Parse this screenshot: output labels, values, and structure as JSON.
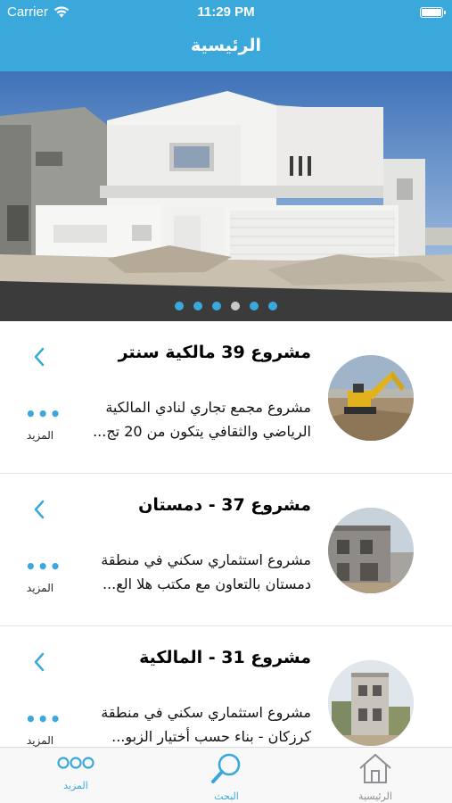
{
  "status_bar": {
    "carrier": "Carrier",
    "time": "11:29 PM",
    "battery_level": 1.0
  },
  "nav": {
    "title": "الرئيسية"
  },
  "slider": {
    "pages": 6,
    "active_index": 3
  },
  "list": {
    "items": [
      {
        "title": "مشروع 39 مالكية سنتر",
        "line1": "مشروع مجمع تجاري لنادي المالكية",
        "line2": "الرياضي والثقافي يتكون من 20 تج...",
        "more_label": "المزيد",
        "thumb": "excavator-photo"
      },
      {
        "title": "مشروع 37 - دمستان",
        "line1": "مشروع استثماري سكني في منطقة",
        "line2": "دمستان بالتعاون مع مكتب هلا الع...",
        "more_label": "المزيد",
        "thumb": "construction-photo"
      },
      {
        "title": "مشروع 31 - المالكية",
        "line1": "مشروع استثماري سكني في منطقة",
        "line2": "كرزكان - بناء حسب أختيار الزبو...",
        "more_label": "المزيد",
        "thumb": "building-photo"
      }
    ]
  },
  "tab_bar": {
    "more": {
      "label": "المزيد",
      "icon": "ellipsis-circles-icon"
    },
    "search": {
      "label": "البحث",
      "icon": "magnifier-icon"
    },
    "home": {
      "label": "الرئيسية",
      "icon": "house-icon"
    }
  },
  "colors": {
    "accent": "#3aa8da",
    "divider": "#e3e3e3",
    "inactive": "#8e8e93"
  }
}
